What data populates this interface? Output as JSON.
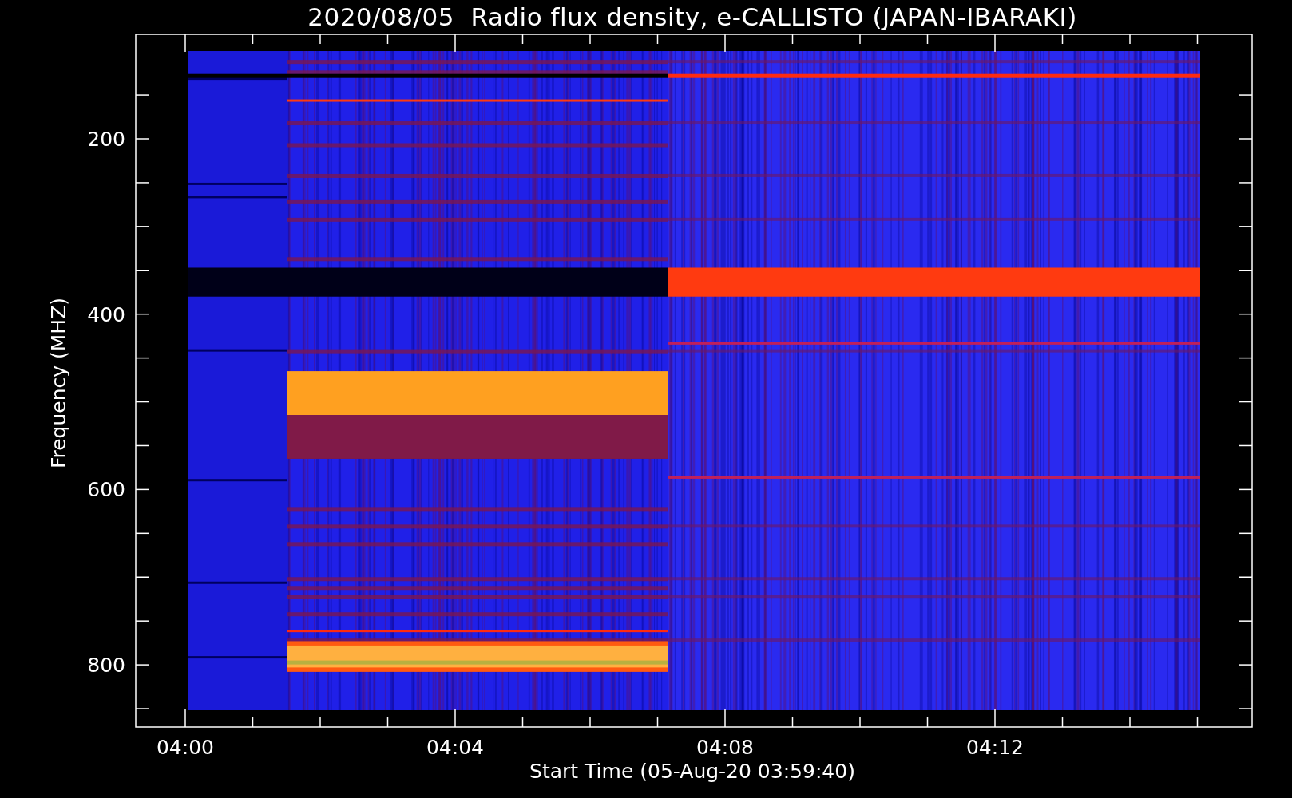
{
  "plot": {
    "title": "2020/08/05  Radio flux density, e-CALLISTO (JAPAN-IBARAKI)",
    "y_axis_label": "Frequency (MHZ)",
    "x_axis_label": "Start Time (05-Aug-20 03:59:40)",
    "y_tick_labels": [
      "200",
      "400",
      "600",
      "800"
    ],
    "x_tick_labels": [
      "04:00",
      "04:04",
      "04:08",
      "04:12"
    ]
  }
}
